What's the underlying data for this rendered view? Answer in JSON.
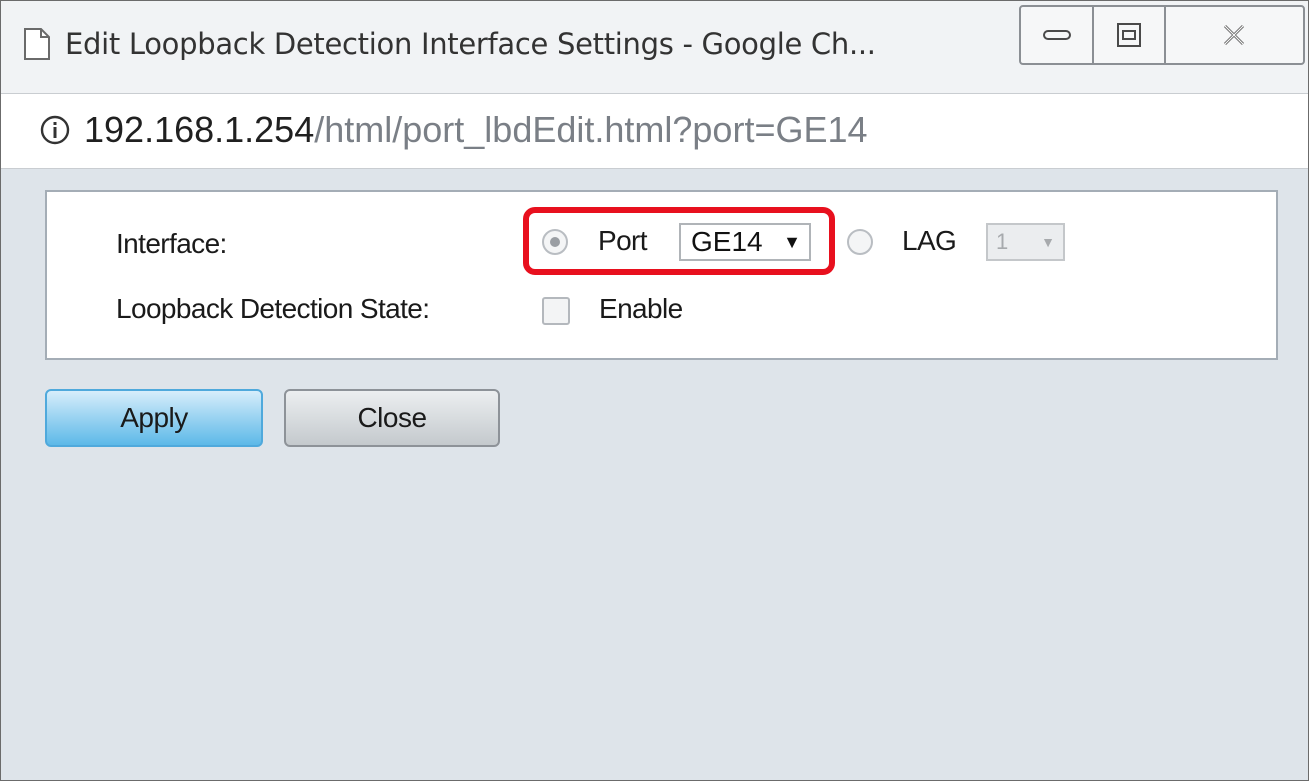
{
  "window": {
    "title": "Edit Loopback Detection Interface Settings - Google Ch...",
    "controls": {
      "minimize": "minimize-icon",
      "maximize": "restore-icon",
      "close": "close-icon"
    }
  },
  "address_bar": {
    "host": "192.168.1.254",
    "path": "/html/port_lbdEdit.html?port=GE14"
  },
  "form": {
    "interface_label": "Interface:",
    "port_option_label": "Port",
    "port_selected": "GE14",
    "lag_option_label": "LAG",
    "lag_selected": "1",
    "loopback_state_label": "Loopback Detection State:",
    "enable_label": "Enable"
  },
  "buttons": {
    "apply": "Apply",
    "close": "Close"
  },
  "colors": {
    "highlight": "#e8101e",
    "apply_button": "#5db9e8",
    "background": "#dee4ea"
  }
}
